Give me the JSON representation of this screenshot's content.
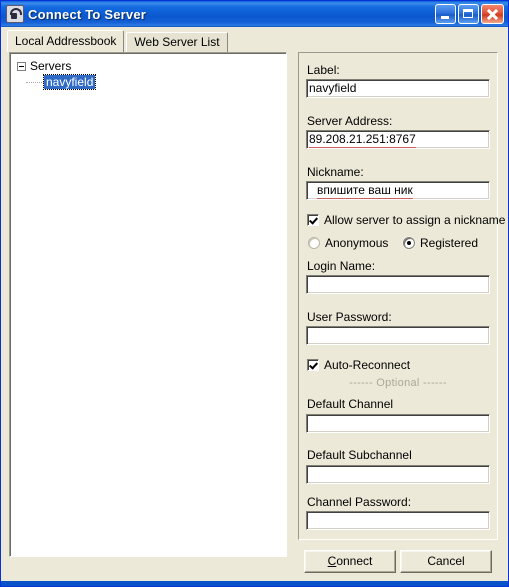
{
  "window": {
    "title": "Connect To Server",
    "icon": "app-icon",
    "minimize_label": "",
    "maximize_label": "",
    "close_label": ""
  },
  "tabs": [
    {
      "label": "Local Addressbook",
      "active": true
    },
    {
      "label": "Web Server List",
      "active": false
    }
  ],
  "tree": {
    "root_label": "Servers",
    "expanded": true,
    "children": [
      {
        "label": "navyfield",
        "selected": true
      }
    ]
  },
  "form": {
    "label_caption": "Label:",
    "label_value": "navyfield",
    "server_address_caption": "Server Address:",
    "server_address_value": "89.208.21.251:8767",
    "nickname_caption": "Nickname:",
    "nickname_value": "впишите ваш ник",
    "allow_assign_nickname": "Allow server to assign a nickname",
    "allow_assign_nickname_checked": true,
    "anonymous_label": "Anonymous",
    "anonymous_selected": false,
    "registered_label": "Registered",
    "registered_selected": true,
    "login_name_caption": "Login Name:",
    "login_name_value": "",
    "user_password_caption": "User Password:",
    "user_password_value": "",
    "auto_reconnect_label": "Auto-Reconnect",
    "auto_reconnect_checked": true,
    "optional_separator": "------ Optional ------",
    "default_channel_caption": "Default Channel",
    "default_channel_value": "",
    "default_subchannel_caption": "Default Subchannel",
    "default_subchannel_value": "",
    "channel_password_caption": "Channel Password:",
    "channel_password_value": ""
  },
  "buttons": {
    "connect_accel": "C",
    "connect_rest": "onnect",
    "cancel_label": "Cancel"
  },
  "colors": {
    "titlebar_blue": "#0A60D8",
    "dialog_face": "#ECE9D8",
    "selection_blue": "#316AC5",
    "spellcheck_red": "#D06060",
    "optional_gray": "#ACA899"
  }
}
